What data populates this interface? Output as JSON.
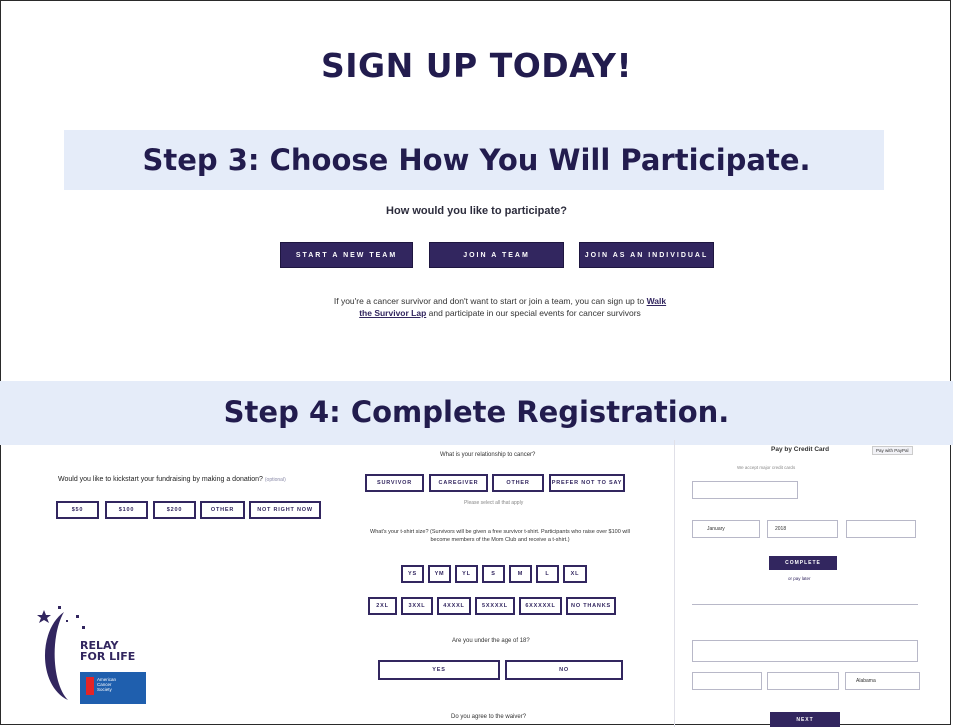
{
  "header": {
    "title": "SIGN UP TODAY!"
  },
  "step3": {
    "heading": "Step 3: Choose How You Will Participate.",
    "question": "How would you like to participate?",
    "buttons": [
      "START A NEW TEAM",
      "JOIN A TEAM",
      "JOIN AS AN INDIVIDUAL"
    ],
    "note_before": "If you're a cancer survivor and don't want to start or join a team, you can sign up to ",
    "note_link": "Walk the Survivor Lap",
    "note_after": " and participate in our special events for cancer survivors"
  },
  "step4": {
    "heading": "Step 4: Complete Registration.",
    "donation": {
      "question": "Would you like to kickstart your fundraising by making a donation?",
      "optional": "(optional)",
      "options": [
        "$50",
        "$100",
        "$200",
        "OTHER",
        "NOT RIGHT NOW"
      ]
    },
    "relationship": {
      "question": "What is your relationship to cancer?",
      "options": [
        "SURVIVOR",
        "CAREGIVER",
        "OTHER",
        "PREFER NOT TO SAY"
      ],
      "hint": "Please select all that apply"
    },
    "shirt": {
      "question": "What's your t-shirt size? (Survivors will be given a free survivor t-shirt. Participants who raise over $100 will become members of the Mom Club and receive a t-shirt.)",
      "sizes_row1": [
        "YS",
        "YM",
        "YL",
        "S",
        "M",
        "L",
        "XL"
      ],
      "sizes_row2": [
        "2XL",
        "3XXL",
        "4XXXL",
        "5XXXXL",
        "6XXXXXL",
        "NO THANKS"
      ]
    },
    "age": {
      "question": "Are you under the age of 18?",
      "options": [
        "YES",
        "NO"
      ]
    },
    "waiver": {
      "question": "Do you agree to the waiver?"
    },
    "payment": {
      "title": "Pay by Credit Card",
      "badge": "Pay with PayPal",
      "secure_note": "We accept major credit cards",
      "exp_month_value": "January",
      "exp_year_value": "2018",
      "complete_label": "COMPLETE",
      "link_label": "or pay later",
      "next_label": "NEXT",
      "state_value": "Alabama"
    }
  },
  "logo": {
    "line1": "RELAY",
    "line2": "FOR LIFE",
    "org": "American Cancer Society"
  },
  "colors": {
    "brand": "#32265f",
    "heading": "#221c4e",
    "band": "#e5ecf9"
  }
}
